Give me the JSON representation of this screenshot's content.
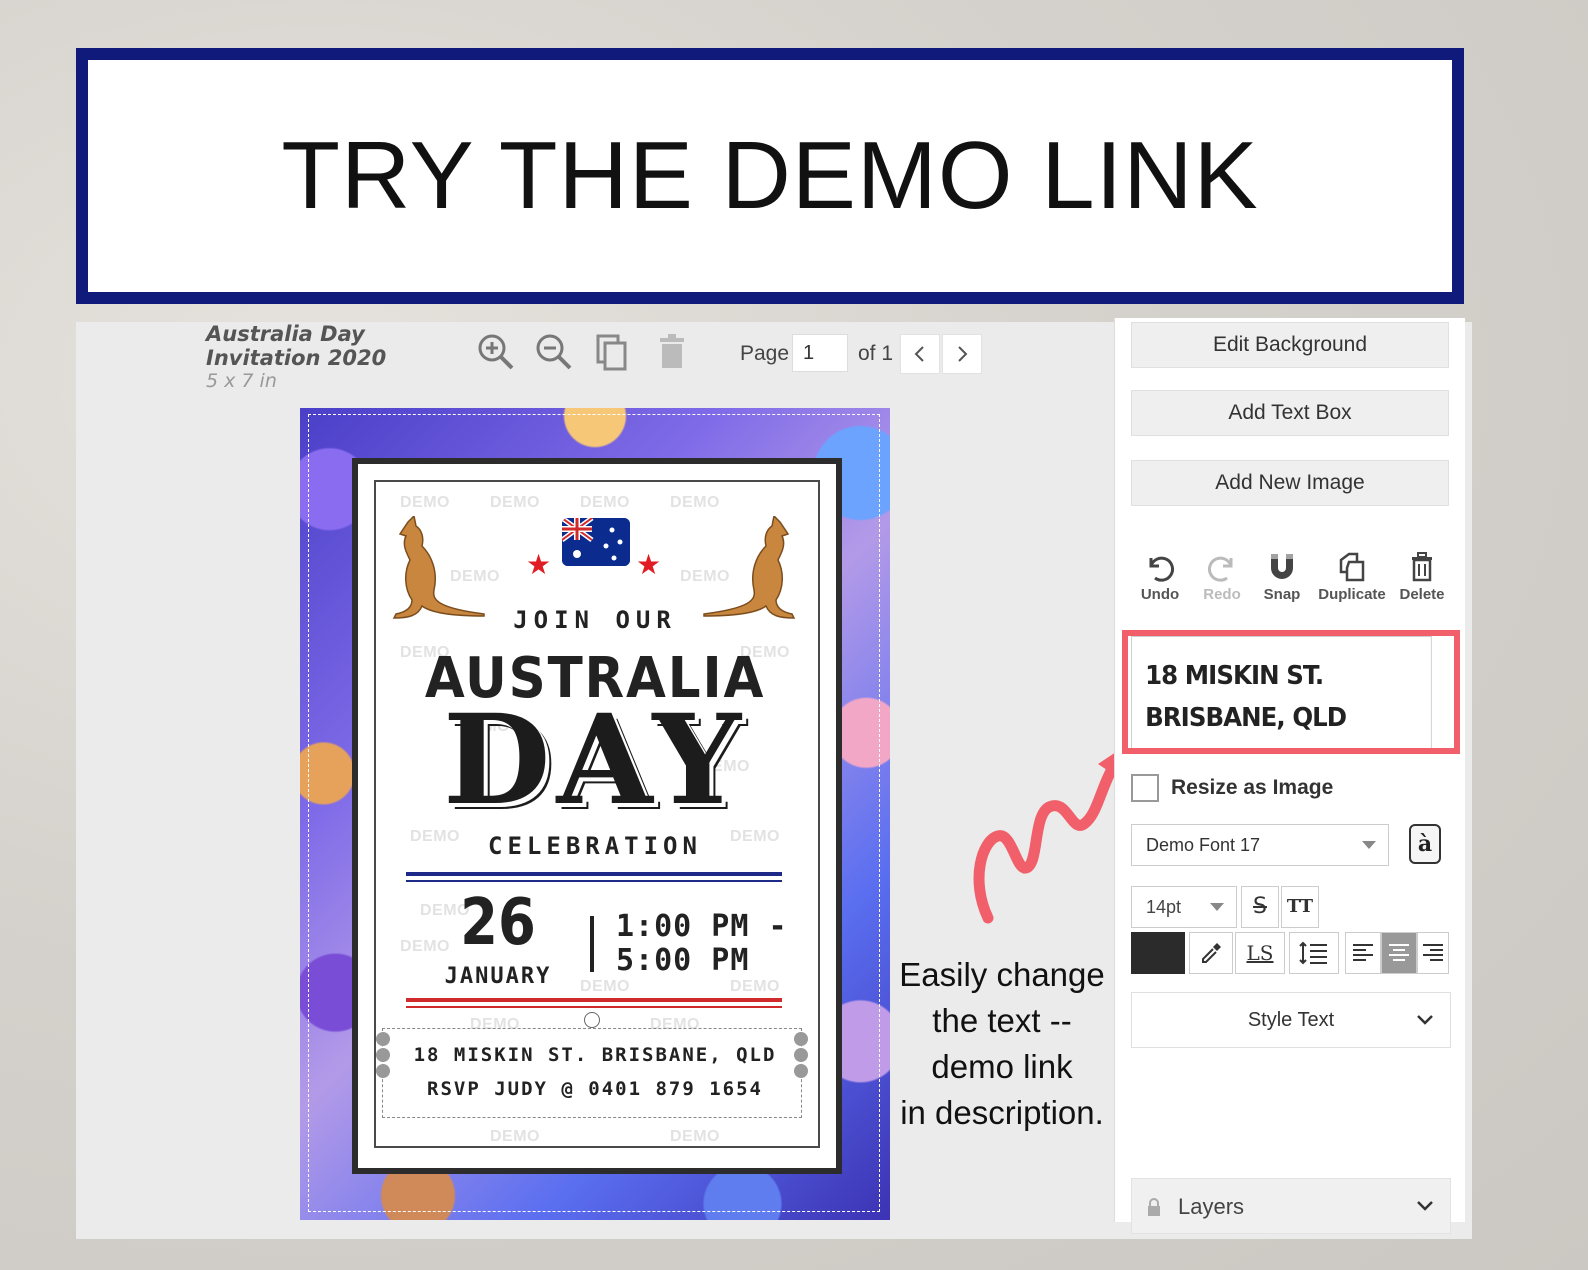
{
  "banner": {
    "title": "TRY THE DEMO LINK"
  },
  "document": {
    "title": "Australia Day Invitation 2020",
    "size": "5 x 7 in"
  },
  "toolbar": {
    "icons": [
      "zoom-in-icon",
      "zoom-out-icon",
      "copy-page-icon",
      "trash-page-icon"
    ],
    "page_label": "Page",
    "page_value": "1",
    "page_of": "of 1"
  },
  "invitation": {
    "join": "JOIN OUR",
    "australia": "AUSTRALIA",
    "day": "DAY",
    "celebration": "CELEBRATION",
    "date_number": "26",
    "date_month": "JANUARY",
    "time_start": "1:00 PM -",
    "time_end": "5:00 PM",
    "address": "18 MISKIN ST. BRISBANE, QLD",
    "rsvp": "RSVP JUDY @ 0401 879 1654",
    "watermark": "DEMO"
  },
  "annotation": {
    "lines": [
      "Easily change",
      "the text --",
      "demo link",
      "in description."
    ]
  },
  "panel": {
    "edit_background": "Edit Background",
    "add_text_box": "Add Text Box",
    "add_new_image": "Add New Image",
    "actions": {
      "undo": "Undo",
      "redo": "Redo",
      "snap": "Snap",
      "duplicate": "Duplicate",
      "delete": "Delete"
    },
    "text_preview": "18 MISKIN ST. BRISBANE, QLD",
    "resize_label": "Resize as Image",
    "font_select": "Demo Font 17",
    "glyph_button": "à",
    "size_select": "14pt",
    "strike_button": "S",
    "caps_button": "TT",
    "letter_spacing_button": "LS",
    "text_color": "#2b2b2b",
    "style_text": "Style Text",
    "layers": "Layers"
  },
  "colors": {
    "banner_border": "#0f1a7a",
    "highlight": "#f05f6a",
    "arrow": "#f05f6a"
  }
}
